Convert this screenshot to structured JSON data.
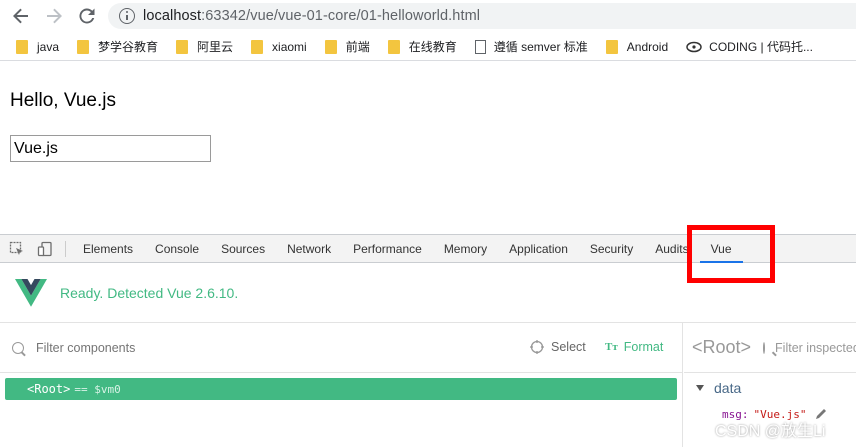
{
  "browser": {
    "url_host": "localhost",
    "url_rest": ":63342/vue/vue-01-core/01-helloworld.html",
    "bookmarks": [
      {
        "label": "java",
        "icon": "folder-icon"
      },
      {
        "label": "梦学谷教育",
        "icon": "folder-icon"
      },
      {
        "label": "阿里云",
        "icon": "folder-icon"
      },
      {
        "label": "xiaomi",
        "icon": "folder-icon"
      },
      {
        "label": "前端",
        "icon": "folder-icon"
      },
      {
        "label": "在线教育",
        "icon": "folder-icon"
      },
      {
        "label": "遵循 semver 标准",
        "icon": "page-icon"
      },
      {
        "label": "Android",
        "icon": "folder-icon"
      },
      {
        "label": "CODING | 代码托...",
        "icon": "coding-icon"
      }
    ]
  },
  "page": {
    "title": "Hello, Vue.js",
    "input_value": "Vue.js"
  },
  "devtools": {
    "tabs": [
      "Elements",
      "Console",
      "Sources",
      "Network",
      "Performance",
      "Memory",
      "Application",
      "Security",
      "Audits",
      "Vue"
    ],
    "active_tab": "Vue",
    "vue": {
      "status": "Ready. Detected Vue 2.6.10.",
      "filter_components_placeholder": "Filter components",
      "select_label": "Select",
      "format_label": "Format",
      "root_label": "<Root>",
      "root_vm": "== $vm0",
      "inspector_root": "<Root>",
      "filter_inspected_placeholder": "Filter inspected data",
      "data_section": "data",
      "data_key": "msg:",
      "data_value": "\"Vue.js\""
    }
  },
  "watermark": "CSDN @放生Li",
  "colors": {
    "vue_green": "#42b983",
    "highlight_red": "#ff0000",
    "tab_underline": "#1a73e8"
  }
}
